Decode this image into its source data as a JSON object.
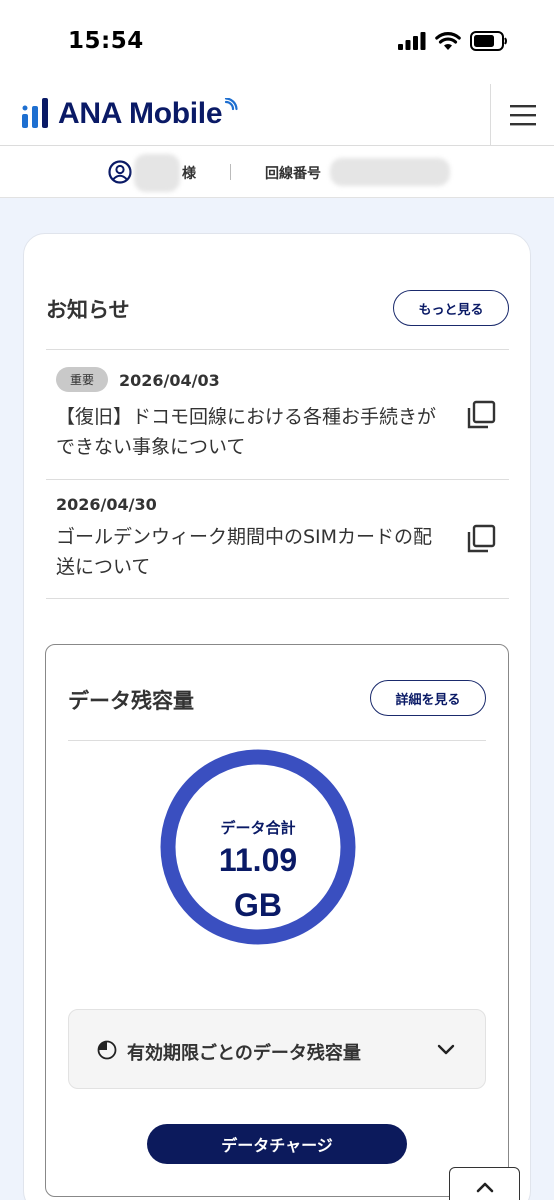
{
  "status": {
    "time": "15:54"
  },
  "header": {
    "logo": "ANA Mobile"
  },
  "user": {
    "honorific": "様",
    "line_label": "回線番号"
  },
  "news": {
    "title": "お知らせ",
    "more_label": "もっと見る",
    "items": [
      {
        "badge": "重要",
        "date": "2026/04/03",
        "title": "【復旧】ドコモ回線における各種お手続きができない事象について"
      },
      {
        "badge": "",
        "date": "2026/04/30",
        "title": "ゴールデンウィーク期間中のSIMカードの配送について"
      }
    ]
  },
  "data": {
    "title": "データ残容量",
    "detail_label": "詳細を見る",
    "gauge_label": "データ合計",
    "gauge_value": "11.09",
    "gauge_unit": "GB",
    "accordion_label": "有効期限ごとのデータ残容量",
    "charge_label": "データチャージ"
  },
  "colors": {
    "brand": "#0a1a66",
    "ring": "#3a4fc0",
    "button": "#0c1a5c"
  }
}
